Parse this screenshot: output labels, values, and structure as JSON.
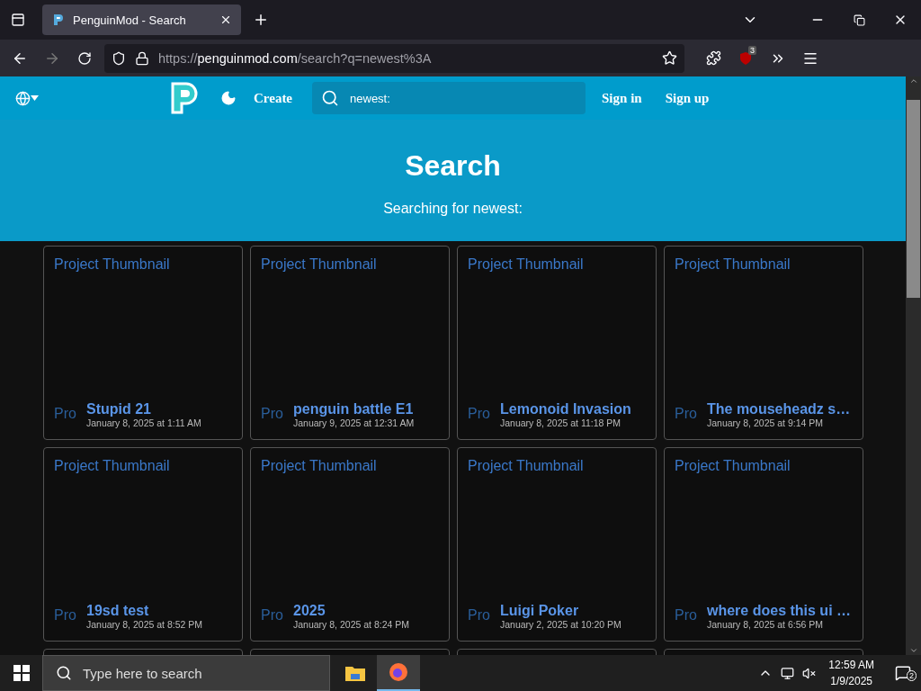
{
  "browser": {
    "tab_title": "PenguinMod - Search",
    "url_host": "https://penguinmod.com",
    "url_path": "/search?q=newest%3A",
    "extension_badge": "3"
  },
  "nav": {
    "create": "Create",
    "search_value": "newest:",
    "sign_in": "Sign in",
    "sign_up": "Sign up"
  },
  "hero": {
    "title": "Search",
    "subtitle": "Searching for newest:"
  },
  "projects": [
    {
      "thumbnail_alt": "Project Thumbnail",
      "avatar_alt": "Pro",
      "title": "Stupid 21",
      "date": "January 8, 2025 at 1:11 AM"
    },
    {
      "thumbnail_alt": "Project Thumbnail",
      "avatar_alt": "Pro",
      "title": "penguin battle E1",
      "date": "January 9, 2025 at 12:31 AM"
    },
    {
      "thumbnail_alt": "Project Thumbnail",
      "avatar_alt": "Pro",
      "title": "Lemonoid Invasion",
      "date": "January 8, 2025 at 11:18 PM"
    },
    {
      "thumbnail_alt": "Project Thumbnail",
      "avatar_alt": "Pro",
      "title": "The mouseheadz s…",
      "date": "January 8, 2025 at 9:14 PM"
    },
    {
      "thumbnail_alt": "Project Thumbnail",
      "avatar_alt": "Pro",
      "title": "19sd test",
      "date": "January 8, 2025 at 8:52 PM"
    },
    {
      "thumbnail_alt": "Project Thumbnail",
      "avatar_alt": "Pro",
      "title": "2025",
      "date": "January 8, 2025 at 8:24 PM"
    },
    {
      "thumbnail_alt": "Project Thumbnail",
      "avatar_alt": "Pro",
      "title": "Luigi Poker",
      "date": "January 2, 2025 at 10:20 PM"
    },
    {
      "thumbnail_alt": "Project Thumbnail",
      "avatar_alt": "Pro",
      "title": "where does this ui …",
      "date": "January 8, 2025 at 6:56 PM"
    }
  ],
  "taskbar": {
    "search_placeholder": "Type here to search",
    "time": "12:59 AM",
    "date": "1/9/2025",
    "notifications": "2"
  }
}
